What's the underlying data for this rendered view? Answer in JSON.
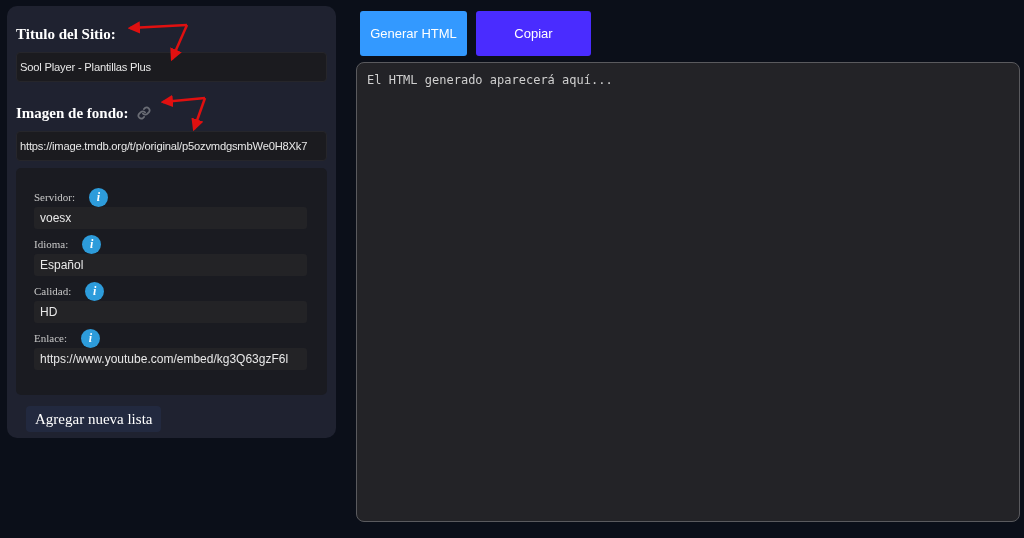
{
  "site_title": {
    "label": "Titulo del Sitio:",
    "value": "Sool Player - Plantillas Plus"
  },
  "background_image": {
    "label": "Imagen de fondo:",
    "value": "https://image.tmdb.org/t/p/original/p5ozvmdgsmbWe0H8Xk7"
  },
  "list_fields": [
    {
      "label": "Servidor:",
      "value": "voesx",
      "info": "i"
    },
    {
      "label": "Idioma:",
      "value": "Español",
      "info": "i"
    },
    {
      "label": "Calidad:",
      "value": "HD",
      "info": "i"
    },
    {
      "label": "Enlace:",
      "value": "https://www.youtube.com/embed/kg3Q63gzF6l",
      "info": "i"
    }
  ],
  "add_list_button": "Agregar nueva lista",
  "actions": [
    {
      "label": "Generar HTML",
      "color": "#3399ff"
    },
    {
      "label": "Copiar",
      "color": "#4a2cff"
    }
  ],
  "output": {
    "placeholder": "El HTML generado aparecerá aquí..."
  }
}
